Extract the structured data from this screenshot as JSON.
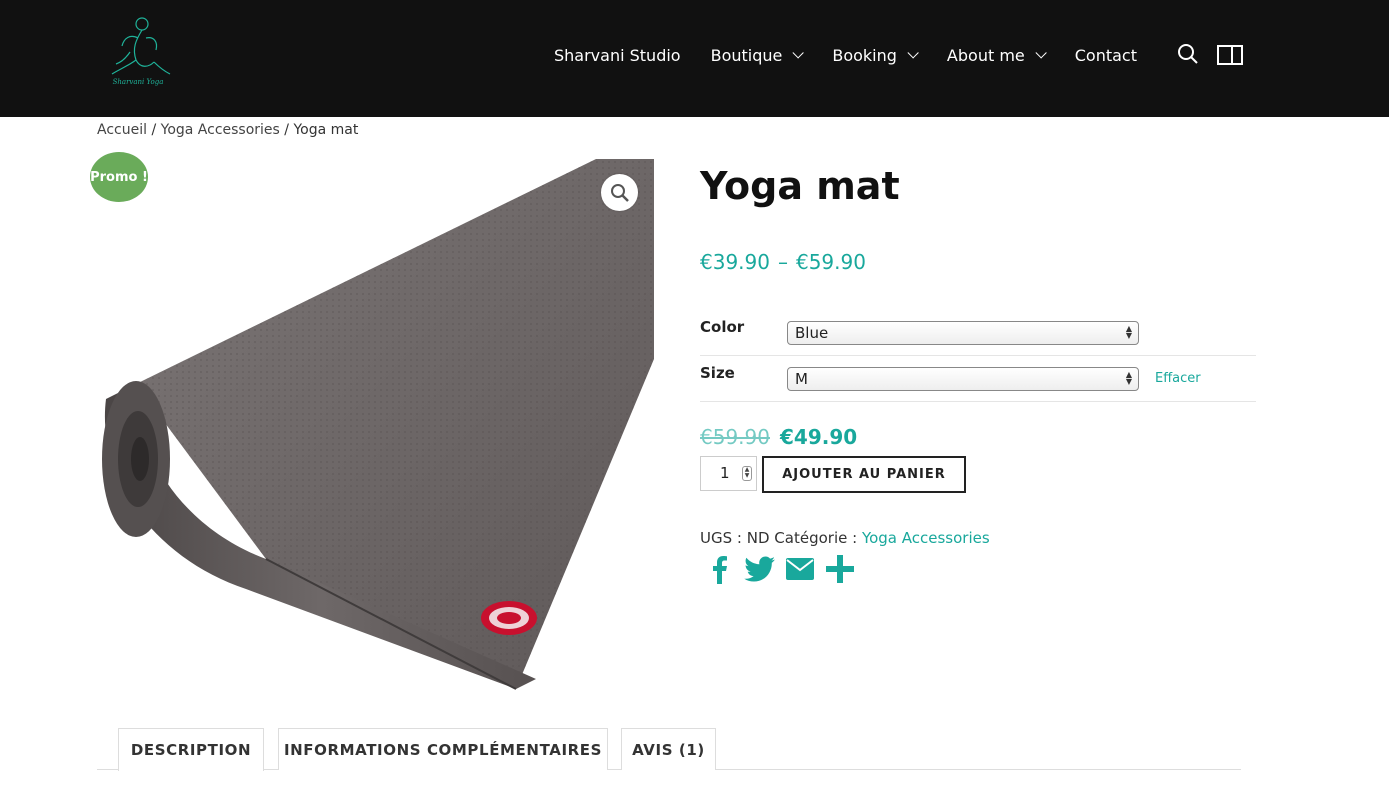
{
  "header": {
    "logo_alt": "Sharvani Yoga",
    "nav": [
      {
        "label": "Sharvani Studio",
        "dropdown": false
      },
      {
        "label": "Boutique",
        "dropdown": true
      },
      {
        "label": "Booking",
        "dropdown": true
      },
      {
        "label": "About me",
        "dropdown": true
      },
      {
        "label": "Contact",
        "dropdown": false
      }
    ],
    "icons": [
      "search-icon",
      "sidebar-toggle-icon"
    ]
  },
  "breadcrumb": {
    "items": [
      "Accueil",
      "Yoga Accessories",
      "Yoga mat"
    ],
    "separator": "/"
  },
  "product": {
    "badge": "Promo !",
    "title": "Yoga mat",
    "price_min": "€39.90",
    "price_sep": "–",
    "price_max": "€59.90",
    "variations": [
      {
        "label": "Color",
        "selected": "Blue"
      },
      {
        "label": "Size",
        "selected": "M"
      }
    ],
    "reset_label": "Effacer",
    "regular_price": "€59.90",
    "sale_price": "€49.90",
    "quantity": "1",
    "add_to_cart": "AJOUTER AU PANIER",
    "sku_label": "UGS :",
    "sku_value": "ND",
    "category_label": "Catégorie :",
    "category_value": "Yoga Accessories",
    "share_icons": [
      "facebook-icon",
      "twitter-icon",
      "email-icon",
      "share-icon"
    ]
  },
  "tabs": [
    {
      "label": "DESCRIPTION",
      "active": true
    },
    {
      "label": "INFORMATIONS COMPLÉMENTAIRES",
      "active": false
    },
    {
      "label": "AVIS (1)",
      "active": false
    }
  ],
  "colors": {
    "header_bg": "#111111",
    "accent": "#19a89c",
    "badge": "#6aab5a"
  }
}
